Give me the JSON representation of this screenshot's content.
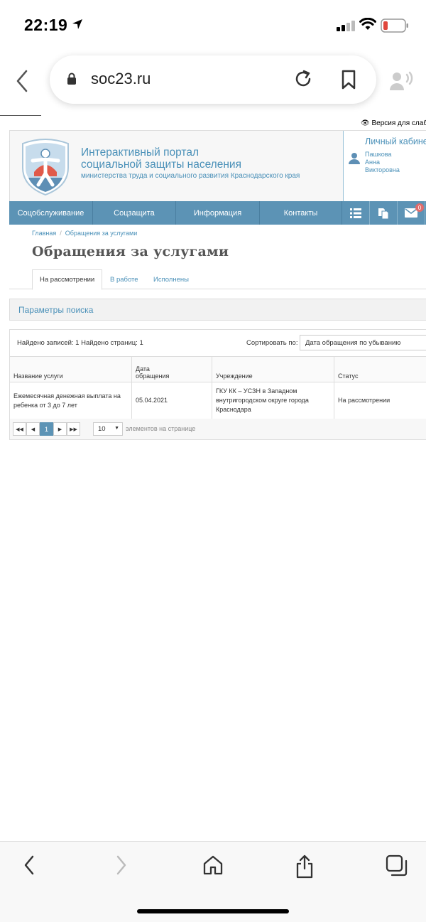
{
  "status": {
    "time": "22:19"
  },
  "browser": {
    "url": "soc23.ru"
  },
  "page": {
    "accessibility_link": "Версия для слабо",
    "header": {
      "title_line1": "Интерактивный портал",
      "title_line2": "социальной защиты населения",
      "subtitle": "министерства труда и социального развития Краснодарского края"
    },
    "cabinet": {
      "title": "Личный кабине",
      "user_line1": "Пашкова",
      "user_line2": "Анна",
      "user_line3": "Викторовна"
    },
    "nav": {
      "items": [
        "Соцобслуживание",
        "Соцзащита",
        "Информация",
        "Контакты"
      ],
      "mail_badge": "0"
    },
    "breadcrumb": {
      "home": "Главная",
      "current": "Обращения за услугами"
    },
    "title": "Обращения за услугами",
    "tabs": [
      "На рассмотрении",
      "В работе",
      "Исполнены"
    ],
    "search_panel": "Параметры поиска",
    "results": {
      "found": "Найдено записей: 1 Найдено страниц: 1",
      "sort_label": "Сортировать по:",
      "sort_value": "Дата обращения по убыванию"
    },
    "table": {
      "headers": [
        "Название услуги",
        "Дата обращения",
        "Учреждение",
        "Статус"
      ],
      "rows": [
        {
          "service": "Ежемесячная денежная выплата на ребенка от 3 до 7 лет",
          "date": "05.04.2021",
          "institution": "ГКУ КК – УСЗН в Западном внутригородском округе города Краснодара",
          "status": "На рассмотрении"
        }
      ]
    },
    "pager": {
      "first": "◀◀",
      "prev": "◀",
      "current": "1",
      "next": "▶",
      "last": "▶▶",
      "per_page": "10",
      "per_page_label": "элементов на странице"
    }
  },
  "icons": {
    "location": "location-arrow-icon",
    "signal": "cell-signal-icon",
    "wifi": "wifi-icon",
    "battery": "battery-low-icon",
    "lock": "lock-icon",
    "reload": "reload-icon",
    "bookmark": "bookmark-icon",
    "reader": "speech-icon"
  },
  "colors": {
    "nav_blue": "#5c93b5",
    "link_blue": "#4a90b8",
    "badge_red": "#e06c6c"
  }
}
